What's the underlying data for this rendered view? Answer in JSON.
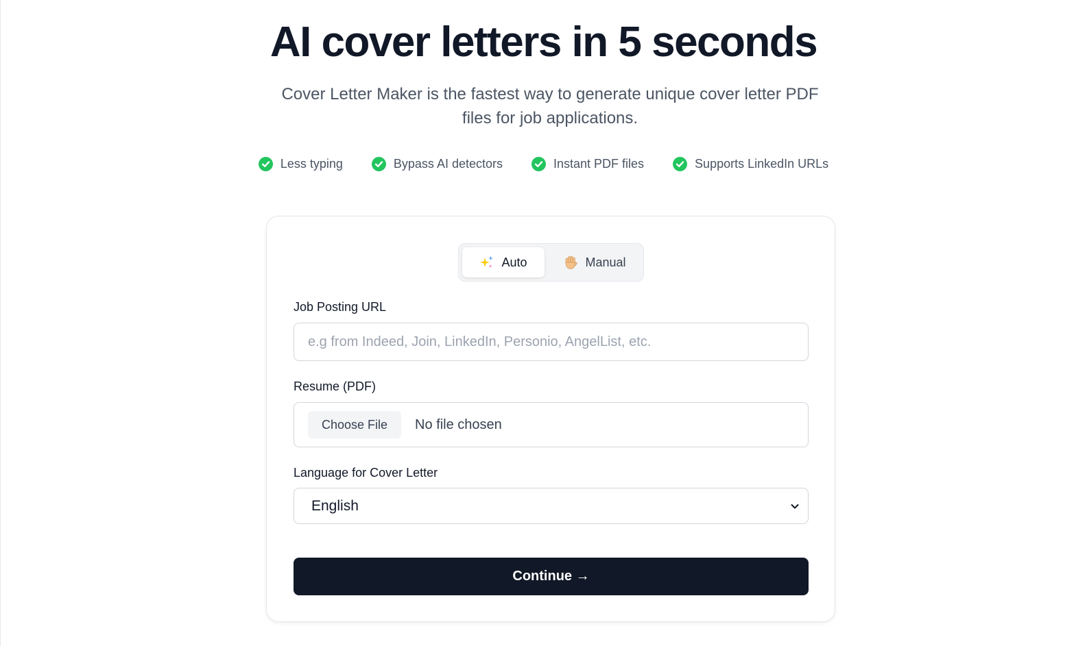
{
  "hero": {
    "title": "AI cover letters in 5 seconds",
    "subtitle": "Cover Letter Maker is the fastest way to generate unique cover letter PDF files for job applications."
  },
  "features": [
    {
      "label": "Less typing",
      "icon": "check-circle-icon"
    },
    {
      "label": "Bypass AI detectors",
      "icon": "check-circle-icon"
    },
    {
      "label": "Instant PDF files",
      "icon": "check-circle-icon"
    },
    {
      "label": "Supports LinkedIn URLs",
      "icon": "check-circle-icon"
    }
  ],
  "mode_toggle": {
    "auto_label": "Auto",
    "auto_icon": "sparkles-icon",
    "manual_label": "Manual",
    "manual_icon": "raised-hand-icon",
    "selected": "Auto"
  },
  "form": {
    "job_url": {
      "label": "Job Posting URL",
      "value": "",
      "placeholder": "e.g from Indeed, Join, LinkedIn, Personio, AngelList, etc."
    },
    "resume": {
      "label": "Resume (PDF)",
      "button_label": "Choose File",
      "status": "No file chosen"
    },
    "language": {
      "label": "Language for Cover Letter",
      "selected": "English"
    },
    "submit_label": "Continue →"
  },
  "colors": {
    "accent_dark": "#111827",
    "check_green": "#22c55e",
    "muted_text": "#4b5563"
  }
}
